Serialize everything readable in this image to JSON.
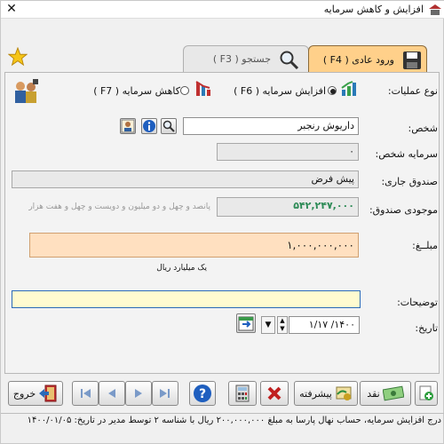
{
  "window": {
    "title": "افزایش و کاهش سرمایه",
    "close_glyph": "✕"
  },
  "tabs": [
    {
      "label": "ورود عادی ( F4 )"
    },
    {
      "label": "جستجو ( F3 )"
    }
  ],
  "operation": {
    "label": "نوع عملیات:",
    "option_increase": "افزایش سرمایه ( F6 )",
    "option_decrease": "کاهش سرمایه ( F7 )",
    "selected": "increase"
  },
  "form": {
    "person_label": "شخص:",
    "person_value": "داریوش رنجبر",
    "capital_label": "سرمایه شخص:",
    "capital_value": "۰",
    "fund_label": "صندوق جاری:",
    "fund_value": "پیش فرض",
    "fund_balance_label": "موجودی صندوق:",
    "fund_balance_value": "۵۴۲,۲۴۷,۰۰۰",
    "fund_balance_words": "پانصد و چهل و دو میلیون و دویست و چهل و هفت هزار",
    "amount_label": "مبلــغ:",
    "amount_value": "۱,۰۰۰,۰۰۰,۰۰۰",
    "amount_words": "یک میلیارد  ریال",
    "description_label": "توضیحات:",
    "description_value": "",
    "date_label": "تاریخ:",
    "date_value": "۱۴۰۰/ ۱/۱۷"
  },
  "toolbar": {
    "cash_label": "نقد",
    "advanced_label": "پیشرفته",
    "exit_label": "خروج"
  },
  "status_bar": "درج افزایش سرمایه، حساب نهال پارسا به مبلغ ۲۰۰,۰۰۰,۰۰۰ ریال با شناسه ۲ توسط مدیر در تاریخ: ۱۴۰۰/۰۱/۰۵",
  "colors": {
    "active_tab": "#ffd08a",
    "amount_bg": "#ffe0c0",
    "description_bg": "#fffbd0",
    "fund_balance_text": "#2e8b57"
  },
  "icons": [
    "close-icon",
    "star-icon",
    "save-icon",
    "search-icon",
    "chart-up-icon",
    "chart-down-icon",
    "people-icon",
    "person-card-icon",
    "info-icon",
    "calendar-icon",
    "add-icon",
    "money-icon",
    "certificate-icon",
    "delete-icon",
    "calculator-icon",
    "help-icon",
    "first-icon",
    "prev-icon",
    "next-icon",
    "last-icon",
    "exit-icon"
  ]
}
